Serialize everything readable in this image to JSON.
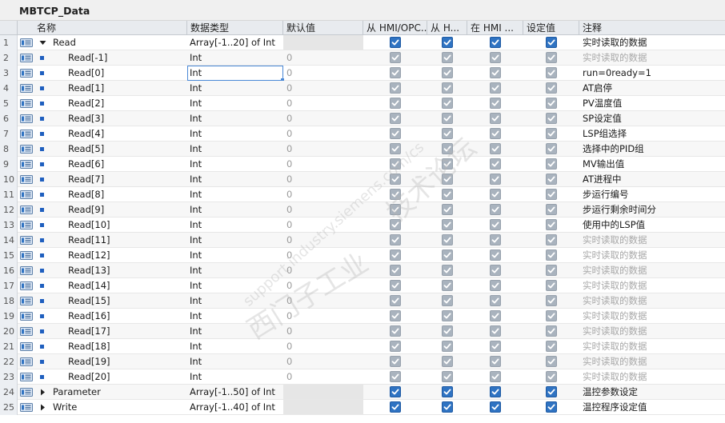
{
  "title": "MBTCP_Data",
  "columns": [
    "",
    "名称",
    "数据类型",
    "默认值",
    "从 HMI/OPC...",
    "从 H...",
    "在 HMI ...",
    "设定值",
    "注释"
  ],
  "watermark": {
    "line1": "西门子工业",
    "line2": "support.industry.siemens.com/cs",
    "line3": "技术论坛"
  },
  "rows": [
    {
      "num": "1",
      "name": "Read",
      "level": 0,
      "expander": "expanded",
      "type": "Array[-1..20] of Int",
      "default": "",
      "hmi_opc": true,
      "from_h": true,
      "in_hmi": true,
      "setpoint": true,
      "setpoint_dim": false,
      "comment": "实时读取的数据",
      "comment_grey": false
    },
    {
      "num": "2",
      "name": "Read[-1]",
      "level": 1,
      "expander": "none",
      "type": "Int",
      "default": "0",
      "hmi_opc": true,
      "from_h": true,
      "in_hmi": true,
      "setpoint": true,
      "setpoint_dim": true,
      "comment": "实时读取的数据",
      "comment_grey": true
    },
    {
      "num": "3",
      "name": "Read[0]",
      "level": 1,
      "expander": "none",
      "type": "Int",
      "default": "0",
      "hmi_opc": true,
      "from_h": true,
      "in_hmi": true,
      "setpoint": true,
      "setpoint_dim": true,
      "comment": "run=0ready=1",
      "comment_grey": false,
      "selected": true
    },
    {
      "num": "4",
      "name": "Read[1]",
      "level": 1,
      "expander": "none",
      "type": "Int",
      "default": "0",
      "hmi_opc": true,
      "from_h": true,
      "in_hmi": true,
      "setpoint": true,
      "setpoint_dim": true,
      "comment": "AT启停",
      "comment_grey": false
    },
    {
      "num": "5",
      "name": "Read[2]",
      "level": 1,
      "expander": "none",
      "type": "Int",
      "default": "0",
      "hmi_opc": true,
      "from_h": true,
      "in_hmi": true,
      "setpoint": true,
      "setpoint_dim": true,
      "comment": "PV温度值",
      "comment_grey": false
    },
    {
      "num": "6",
      "name": "Read[3]",
      "level": 1,
      "expander": "none",
      "type": "Int",
      "default": "0",
      "hmi_opc": true,
      "from_h": true,
      "in_hmi": true,
      "setpoint": true,
      "setpoint_dim": true,
      "comment": "SP设定值",
      "comment_grey": false
    },
    {
      "num": "7",
      "name": "Read[4]",
      "level": 1,
      "expander": "none",
      "type": "Int",
      "default": "0",
      "hmi_opc": true,
      "from_h": true,
      "in_hmi": true,
      "setpoint": true,
      "setpoint_dim": true,
      "comment": "LSP组选择",
      "comment_grey": false
    },
    {
      "num": "8",
      "name": "Read[5]",
      "level": 1,
      "expander": "none",
      "type": "Int",
      "default": "0",
      "hmi_opc": true,
      "from_h": true,
      "in_hmi": true,
      "setpoint": true,
      "setpoint_dim": true,
      "comment": "选择中的PID组",
      "comment_grey": false
    },
    {
      "num": "9",
      "name": "Read[6]",
      "level": 1,
      "expander": "none",
      "type": "Int",
      "default": "0",
      "hmi_opc": true,
      "from_h": true,
      "in_hmi": true,
      "setpoint": true,
      "setpoint_dim": true,
      "comment": "MV输出值",
      "comment_grey": false
    },
    {
      "num": "10",
      "name": "Read[7]",
      "level": 1,
      "expander": "none",
      "type": "Int",
      "default": "0",
      "hmi_opc": true,
      "from_h": true,
      "in_hmi": true,
      "setpoint": true,
      "setpoint_dim": true,
      "comment": "AT进程中",
      "comment_grey": false
    },
    {
      "num": "11",
      "name": "Read[8]",
      "level": 1,
      "expander": "none",
      "type": "Int",
      "default": "0",
      "hmi_opc": true,
      "from_h": true,
      "in_hmi": true,
      "setpoint": true,
      "setpoint_dim": true,
      "comment": "步运行编号",
      "comment_grey": false
    },
    {
      "num": "12",
      "name": "Read[9]",
      "level": 1,
      "expander": "none",
      "type": "Int",
      "default": "0",
      "hmi_opc": true,
      "from_h": true,
      "in_hmi": true,
      "setpoint": true,
      "setpoint_dim": true,
      "comment": "步运行剩余时间分",
      "comment_grey": false
    },
    {
      "num": "13",
      "name": "Read[10]",
      "level": 1,
      "expander": "none",
      "type": "Int",
      "default": "0",
      "hmi_opc": true,
      "from_h": true,
      "in_hmi": true,
      "setpoint": true,
      "setpoint_dim": true,
      "comment": "使用中的LSP值",
      "comment_grey": false
    },
    {
      "num": "14",
      "name": "Read[11]",
      "level": 1,
      "expander": "none",
      "type": "Int",
      "default": "0",
      "hmi_opc": true,
      "from_h": true,
      "in_hmi": true,
      "setpoint": true,
      "setpoint_dim": true,
      "comment": "实时读取的数据",
      "comment_grey": true
    },
    {
      "num": "15",
      "name": "Read[12]",
      "level": 1,
      "expander": "none",
      "type": "Int",
      "default": "0",
      "hmi_opc": true,
      "from_h": true,
      "in_hmi": true,
      "setpoint": true,
      "setpoint_dim": true,
      "comment": "实时读取的数据",
      "comment_grey": true
    },
    {
      "num": "16",
      "name": "Read[13]",
      "level": 1,
      "expander": "none",
      "type": "Int",
      "default": "0",
      "hmi_opc": true,
      "from_h": true,
      "in_hmi": true,
      "setpoint": true,
      "setpoint_dim": true,
      "comment": "实时读取的数据",
      "comment_grey": true
    },
    {
      "num": "17",
      "name": "Read[14]",
      "level": 1,
      "expander": "none",
      "type": "Int",
      "default": "0",
      "hmi_opc": true,
      "from_h": true,
      "in_hmi": true,
      "setpoint": true,
      "setpoint_dim": true,
      "comment": "实时读取的数据",
      "comment_grey": true
    },
    {
      "num": "18",
      "name": "Read[15]",
      "level": 1,
      "expander": "none",
      "type": "Int",
      "default": "0",
      "hmi_opc": true,
      "from_h": true,
      "in_hmi": true,
      "setpoint": true,
      "setpoint_dim": true,
      "comment": "实时读取的数据",
      "comment_grey": true
    },
    {
      "num": "19",
      "name": "Read[16]",
      "level": 1,
      "expander": "none",
      "type": "Int",
      "default": "0",
      "hmi_opc": true,
      "from_h": true,
      "in_hmi": true,
      "setpoint": true,
      "setpoint_dim": true,
      "comment": "实时读取的数据",
      "comment_grey": true
    },
    {
      "num": "20",
      "name": "Read[17]",
      "level": 1,
      "expander": "none",
      "type": "Int",
      "default": "0",
      "hmi_opc": true,
      "from_h": true,
      "in_hmi": true,
      "setpoint": true,
      "setpoint_dim": true,
      "comment": "实时读取的数据",
      "comment_grey": true
    },
    {
      "num": "21",
      "name": "Read[18]",
      "level": 1,
      "expander": "none",
      "type": "Int",
      "default": "0",
      "hmi_opc": true,
      "from_h": true,
      "in_hmi": true,
      "setpoint": true,
      "setpoint_dim": true,
      "comment": "实时读取的数据",
      "comment_grey": true
    },
    {
      "num": "22",
      "name": "Read[19]",
      "level": 1,
      "expander": "none",
      "type": "Int",
      "default": "0",
      "hmi_opc": true,
      "from_h": true,
      "in_hmi": true,
      "setpoint": true,
      "setpoint_dim": true,
      "comment": "实时读取的数据",
      "comment_grey": true
    },
    {
      "num": "23",
      "name": "Read[20]",
      "level": 1,
      "expander": "none",
      "type": "Int",
      "default": "0",
      "hmi_opc": true,
      "from_h": true,
      "in_hmi": true,
      "setpoint": true,
      "setpoint_dim": true,
      "comment": "实时读取的数据",
      "comment_grey": true
    },
    {
      "num": "24",
      "name": "Parameter",
      "level": 0,
      "expander": "collapsed",
      "type": "Array[-1..50] of Int",
      "default": "",
      "hmi_opc": true,
      "from_h": true,
      "in_hmi": true,
      "setpoint": true,
      "setpoint_dim": false,
      "comment": "温控参数设定",
      "comment_grey": false
    },
    {
      "num": "25",
      "name": "Write",
      "level": 0,
      "expander": "collapsed",
      "type": "Array[-1..40] of Int",
      "default": "",
      "hmi_opc": true,
      "from_h": true,
      "in_hmi": true,
      "setpoint": true,
      "setpoint_dim": false,
      "comment": "温控程序设定值",
      "comment_grey": false
    }
  ],
  "colors": {
    "checkbox": "#2f73c2",
    "checkbox_dim": "#a9b3be",
    "selection": "#4a88d6",
    "header_bg": "#e8ebef"
  }
}
